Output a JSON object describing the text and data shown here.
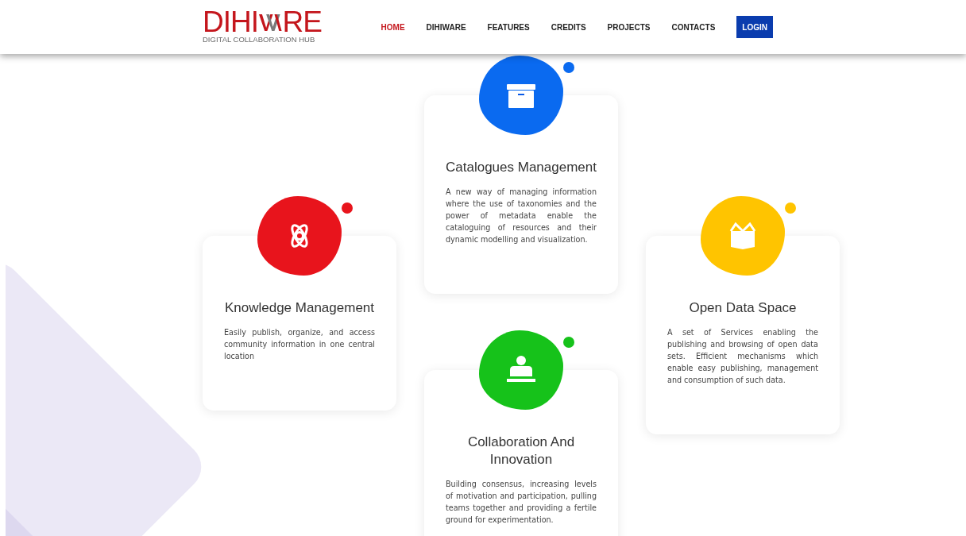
{
  "logo": {
    "text_left": "DIHI",
    "text_right": "RE",
    "tagline": "DIGITAL COLLABORATION HUB"
  },
  "nav": [
    {
      "label": "HOME",
      "selected": true
    },
    {
      "label": "DIHIWARE",
      "selected": false
    },
    {
      "label": "FEATURES",
      "selected": false
    },
    {
      "label": "CREDITS",
      "selected": false
    },
    {
      "label": "PROJECTS",
      "selected": false
    },
    {
      "label": "CONTACTS",
      "selected": false
    }
  ],
  "login": "LOGIN",
  "columns": [
    [
      {
        "kind": "atom",
        "color": "#e8141c",
        "title": "Knowledge Management",
        "text": "Easily publish, organize, and access community information in one central location"
      }
    ],
    [
      {
        "kind": "archive",
        "color": "#0a6af0",
        "title": "Catalogues Management",
        "text": "A new way of managing information where the use of taxonomies and the power of metadata enable the cataloguing of resources and their dynamic modelling and visualization."
      },
      {
        "kind": "teacher",
        "color": "#16c21a",
        "title": "Collaboration And Innovation",
        "text": "Building consensus, increasing levels of motivation and participation, pulling teams together and providing a fertile ground for experimentation."
      }
    ],
    [
      {
        "kind": "box",
        "color": "#ffc400",
        "title": "Open Data Space",
        "text": "A set of Services enabling the publishing and browsing of open data sets. Efficient mechanisms which enable easy publishing, management and consumption of such data."
      }
    ]
  ]
}
